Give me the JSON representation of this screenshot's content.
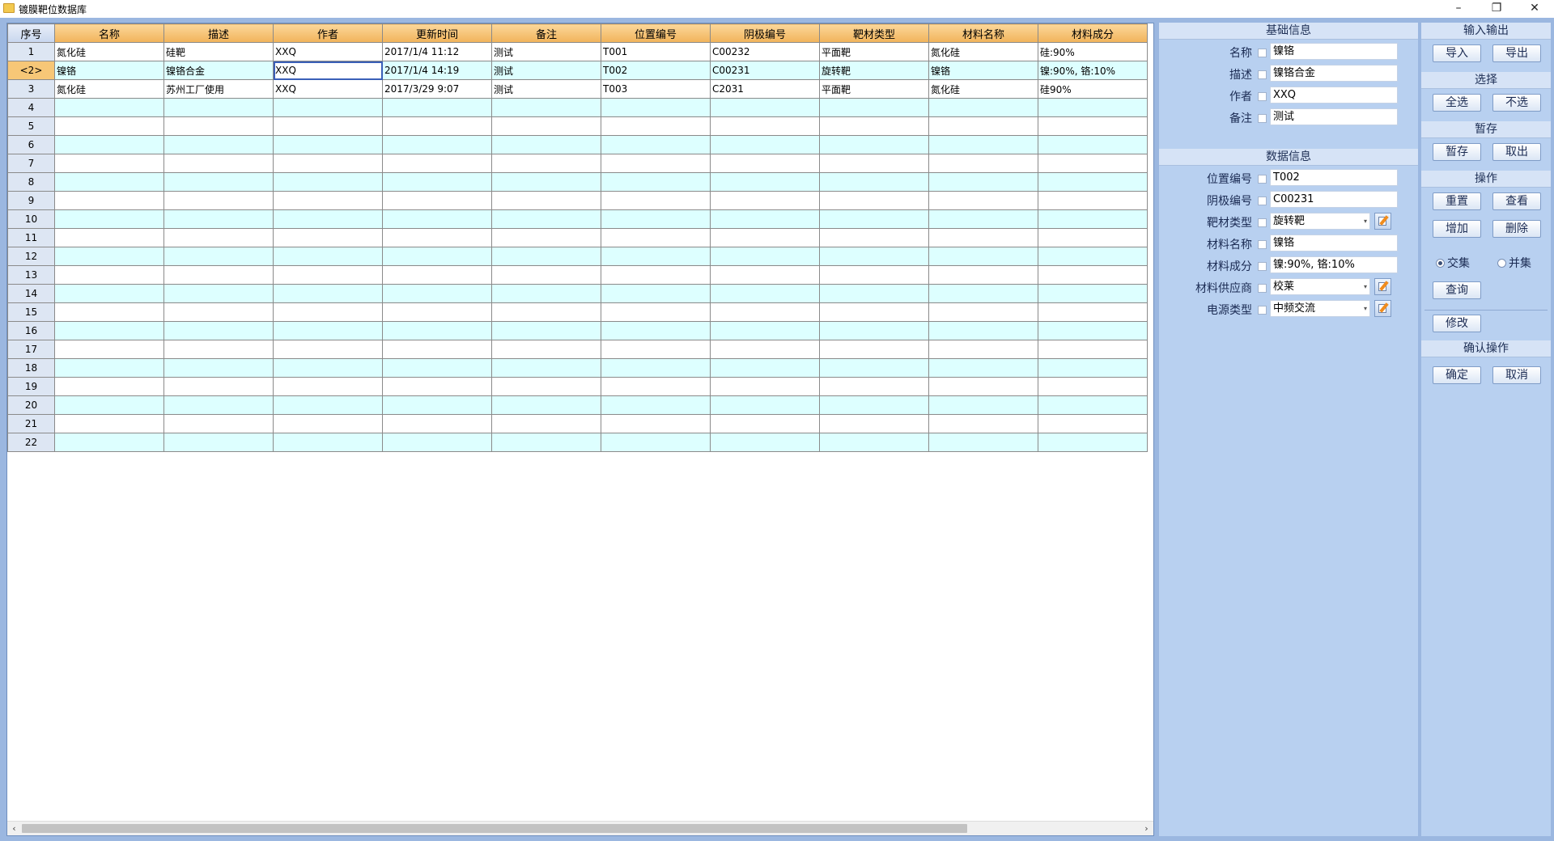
{
  "window": {
    "title": "镀膜靶位数据库",
    "controls": {
      "minimize": "–",
      "maximize": "❐",
      "close": "✕"
    }
  },
  "grid": {
    "headers": [
      "序号",
      "名称",
      "描述",
      "作者",
      "更新时间",
      "备注",
      "位置编号",
      "阴极编号",
      "靶材类型",
      "材料名称",
      "材料成分"
    ],
    "rows": [
      {
        "seq": "1",
        "cells": [
          "氮化硅",
          "硅靶",
          "XXQ",
          "2017/1/4 11:12",
          "测试",
          "T001",
          "C00232",
          "平面靶",
          "氮化硅",
          "硅:90%"
        ]
      },
      {
        "seq": "<2>",
        "cells": [
          "镍铬",
          "镍铬合金",
          "XXQ",
          "2017/1/4 14:19",
          "测试",
          "T002",
          "C00231",
          "旋转靶",
          "镍铬",
          "镍:90%, 铬:10%"
        ]
      },
      {
        "seq": "3",
        "cells": [
          "氮化硅",
          "苏州工厂使用",
          "XXQ",
          "2017/3/29 9:07",
          "测试",
          "T003",
          "C2031",
          "平面靶",
          "氮化硅",
          "硅90%"
        ]
      },
      {
        "seq": "4",
        "cells": [
          "",
          "",
          "",
          "",
          "",
          "",
          "",
          "",
          "",
          ""
        ]
      },
      {
        "seq": "5",
        "cells": [
          "",
          "",
          "",
          "",
          "",
          "",
          "",
          "",
          "",
          ""
        ]
      },
      {
        "seq": "6",
        "cells": [
          "",
          "",
          "",
          "",
          "",
          "",
          "",
          "",
          "",
          ""
        ]
      },
      {
        "seq": "7",
        "cells": [
          "",
          "",
          "",
          "",
          "",
          "",
          "",
          "",
          "",
          ""
        ]
      },
      {
        "seq": "8",
        "cells": [
          "",
          "",
          "",
          "",
          "",
          "",
          "",
          "",
          "",
          ""
        ]
      },
      {
        "seq": "9",
        "cells": [
          "",
          "",
          "",
          "",
          "",
          "",
          "",
          "",
          "",
          ""
        ]
      },
      {
        "seq": "10",
        "cells": [
          "",
          "",
          "",
          "",
          "",
          "",
          "",
          "",
          "",
          ""
        ]
      },
      {
        "seq": "11",
        "cells": [
          "",
          "",
          "",
          "",
          "",
          "",
          "",
          "",
          "",
          ""
        ]
      },
      {
        "seq": "12",
        "cells": [
          "",
          "",
          "",
          "",
          "",
          "",
          "",
          "",
          "",
          ""
        ]
      },
      {
        "seq": "13",
        "cells": [
          "",
          "",
          "",
          "",
          "",
          "",
          "",
          "",
          "",
          ""
        ]
      },
      {
        "seq": "14",
        "cells": [
          "",
          "",
          "",
          "",
          "",
          "",
          "",
          "",
          "",
          ""
        ]
      },
      {
        "seq": "15",
        "cells": [
          "",
          "",
          "",
          "",
          "",
          "",
          "",
          "",
          "",
          ""
        ]
      },
      {
        "seq": "16",
        "cells": [
          "",
          "",
          "",
          "",
          "",
          "",
          "",
          "",
          "",
          ""
        ]
      },
      {
        "seq": "17",
        "cells": [
          "",
          "",
          "",
          "",
          "",
          "",
          "",
          "",
          "",
          ""
        ]
      },
      {
        "seq": "18",
        "cells": [
          "",
          "",
          "",
          "",
          "",
          "",
          "",
          "",
          "",
          ""
        ]
      },
      {
        "seq": "19",
        "cells": [
          "",
          "",
          "",
          "",
          "",
          "",
          "",
          "",
          "",
          ""
        ]
      },
      {
        "seq": "20",
        "cells": [
          "",
          "",
          "",
          "",
          "",
          "",
          "",
          "",
          "",
          ""
        ]
      },
      {
        "seq": "21",
        "cells": [
          "",
          "",
          "",
          "",
          "",
          "",
          "",
          "",
          "",
          ""
        ]
      },
      {
        "seq": "22",
        "cells": [
          "",
          "",
          "",
          "",
          "",
          "",
          "",
          "",
          "",
          ""
        ]
      }
    ],
    "scroll_left": "‹",
    "scroll_right": "›"
  },
  "basic_info": {
    "title": "基础信息",
    "fields": [
      {
        "label": "名称",
        "value": "镍铬"
      },
      {
        "label": "描述",
        "value": "镍铬合金"
      },
      {
        "label": "作者",
        "value": "XXQ"
      },
      {
        "label": "备注",
        "value": "测试"
      }
    ]
  },
  "data_info": {
    "title": "数据信息",
    "fields": [
      {
        "label": "位置编号",
        "value": "T002"
      },
      {
        "label": "阴极编号",
        "value": "C00231"
      },
      {
        "label": "靶材类型",
        "value": "旋转靶"
      },
      {
        "label": "材料名称",
        "value": "镍铬"
      },
      {
        "label": "材料成分",
        "value": "镍:90%, 铬:10%"
      },
      {
        "label": "材料供应商",
        "value": "校莱"
      },
      {
        "label": "电源类型",
        "value": "中频交流"
      }
    ],
    "dropdown_arrow": "▾"
  },
  "actions": {
    "io": {
      "title": "输入输出",
      "import": "导入",
      "export": "导出"
    },
    "select": {
      "title": "选择",
      "all": "全选",
      "none": "不选"
    },
    "stash": {
      "title": "暂存",
      "save": "暂存",
      "load": "取出"
    },
    "ops": {
      "title": "操作",
      "reset": "重置",
      "view": "查看",
      "add": "增加",
      "delete": "删除",
      "intersection": "交集",
      "union": "并集",
      "query": "查询",
      "modify": "修改",
      "selected_mode": "intersection"
    },
    "confirm": {
      "title": "确认操作",
      "ok": "确定",
      "cancel": "取消"
    }
  }
}
